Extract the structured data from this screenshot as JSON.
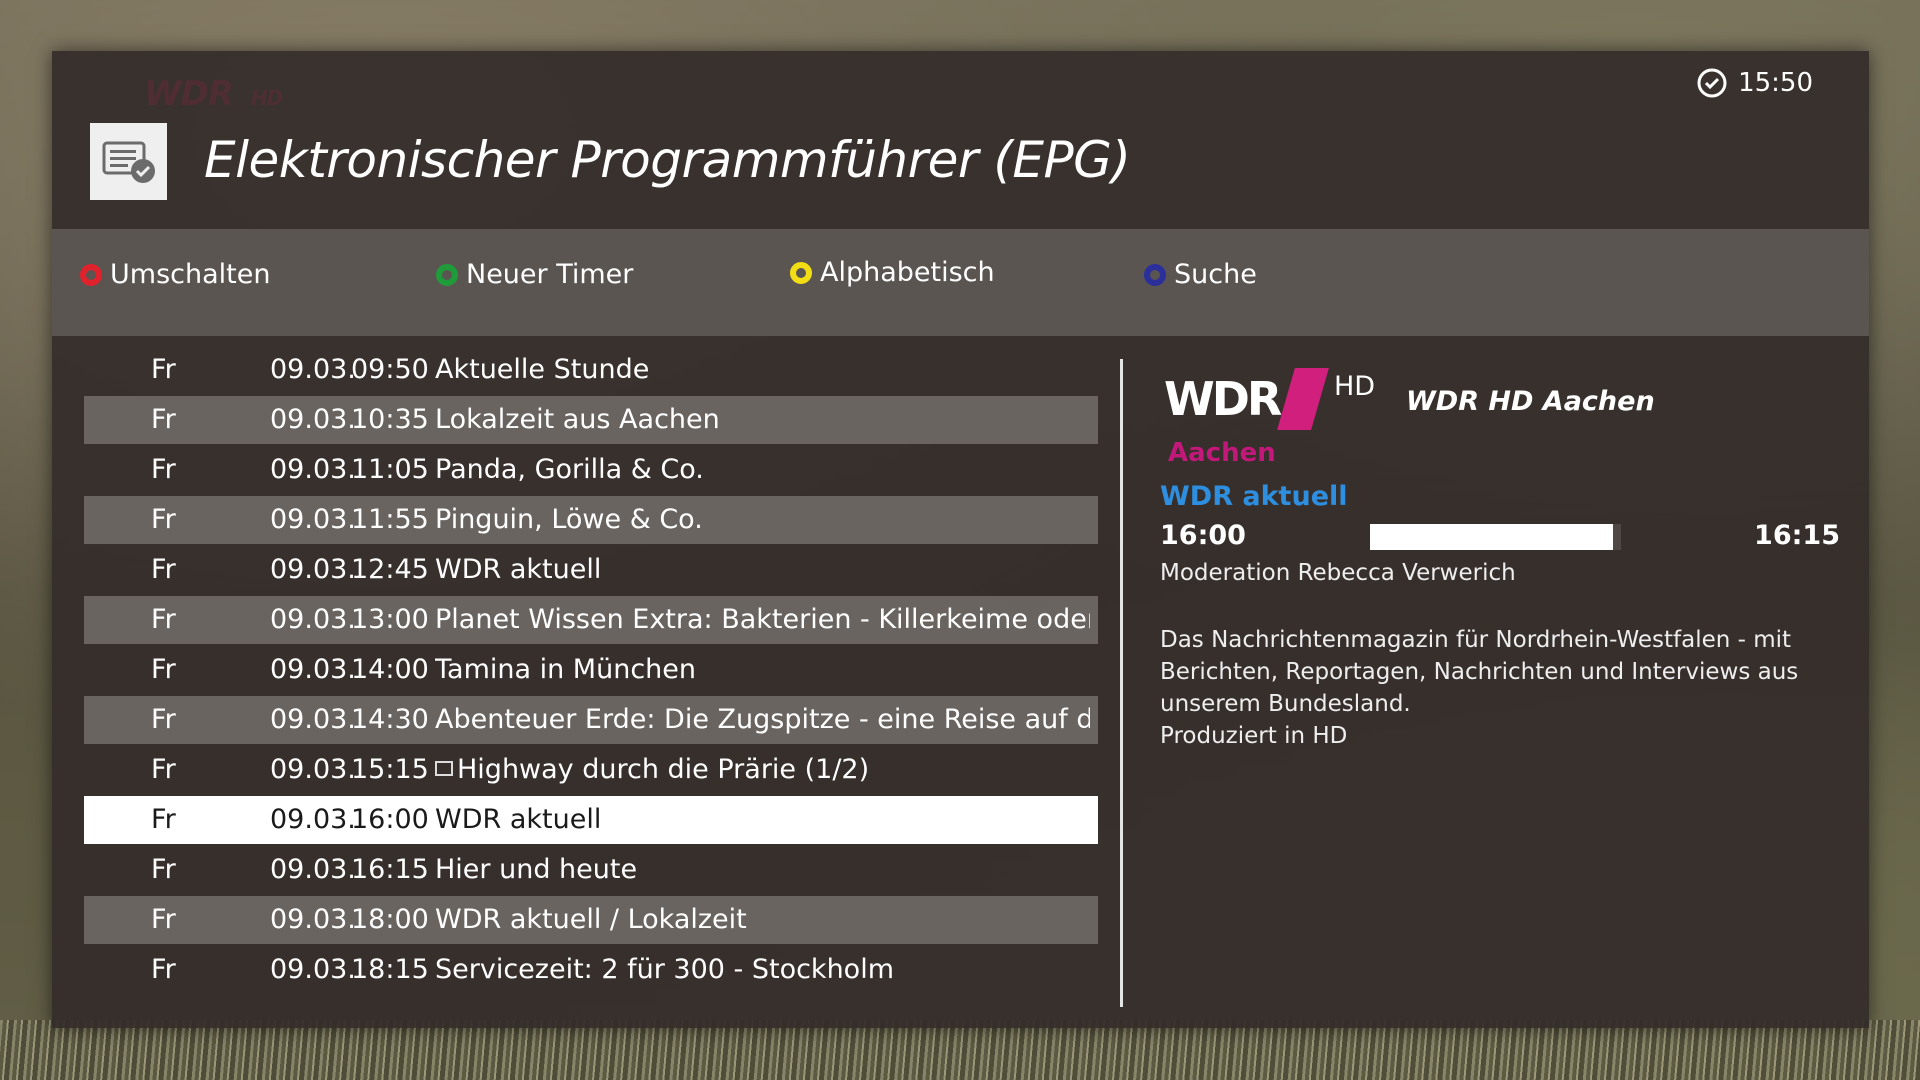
{
  "header": {
    "watermark": "WDR",
    "watermark_suffix": "HD",
    "title": "Elektronischer Programmführer (EPG)",
    "clock": "15:50",
    "app_icon": "epg-list-icon"
  },
  "color_buttons": [
    {
      "label": "Umschalten",
      "color": "#e0222d"
    },
    {
      "label": "Neuer Timer",
      "color": "#1f9b3a"
    },
    {
      "label": "Alphabetisch",
      "color": "#f3de16"
    },
    {
      "label": "Suche",
      "color": "#2a2f9c"
    }
  ],
  "list": [
    {
      "day": "Fr",
      "date": "09.03.",
      "time": "09:50",
      "title": "Aktuelle Stunde"
    },
    {
      "day": "Fr",
      "date": "09.03.",
      "time": "10:35",
      "title": "Lokalzeit aus Aachen"
    },
    {
      "day": "Fr",
      "date": "09.03.",
      "time": "11:05",
      "title": "Panda, Gorilla & Co."
    },
    {
      "day": "Fr",
      "date": "09.03.",
      "time": "11:55",
      "title": "Pinguin, Löwe & Co."
    },
    {
      "day": "Fr",
      "date": "09.03.",
      "time": "12:45",
      "title": "WDR aktuell"
    },
    {
      "day": "Fr",
      "date": "09.03.",
      "time": "13:00",
      "title": "Planet Wissen Extra: Bakterien - Killerkeime oder Nützl"
    },
    {
      "day": "Fr",
      "date": "09.03.",
      "time": "14:00",
      "title": "Tamina in München"
    },
    {
      "day": "Fr",
      "date": "09.03.",
      "time": "14:30",
      "title": "Abenteuer Erde: Die Zugspitze - eine Reise auf den hö"
    },
    {
      "day": "Fr",
      "date": "09.03.",
      "time": "15:15",
      "title": "Highway durch die Prärie (1/2)"
    },
    {
      "day": "Fr",
      "date": "09.03.",
      "time": "16:00",
      "title": "WDR aktuell"
    },
    {
      "day": "Fr",
      "date": "09.03.",
      "time": "16:15",
      "title": "Hier und heute"
    },
    {
      "day": "Fr",
      "date": "09.03.",
      "time": "18:00",
      "title": "WDR aktuell / Lokalzeit"
    },
    {
      "day": "Fr",
      "date": "09.03.",
      "time": "18:15",
      "title": "Servicezeit: 2 für 300 - Stockholm"
    }
  ],
  "selected_index": 9,
  "recording_index": 8,
  "detail": {
    "logo_text": "WDR",
    "logo_hd": "HD",
    "logo_region": "Aachen",
    "channel_name": "WDR HD Aachen",
    "program_title": "WDR aktuell",
    "start": "16:00",
    "end": "16:15",
    "progress": 0.97,
    "moderation": "Moderation Rebecca Verwerich",
    "description": [
      "Das Nachrichtenmagazin für Nordrhein-Westfalen - mit",
      "Berichten, Reportagen, Nachrichten und Interviews aus",
      "unserem Bundesland.",
      "Produziert in HD"
    ]
  }
}
